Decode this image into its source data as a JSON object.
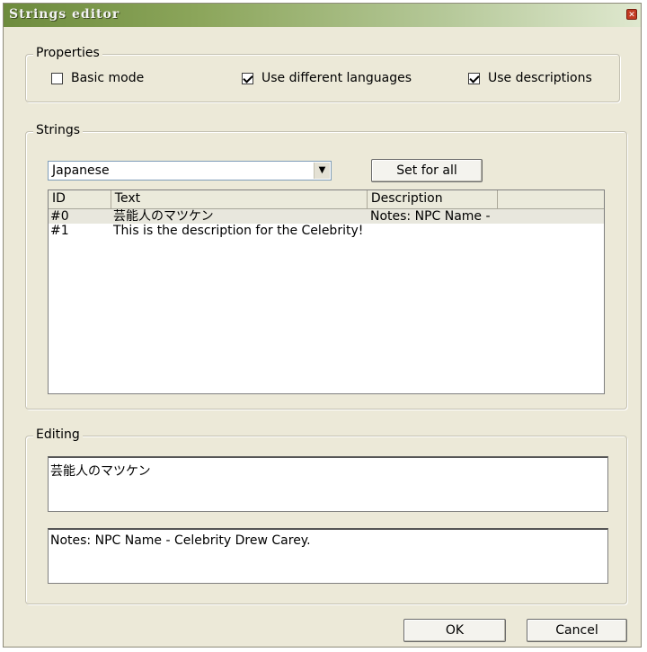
{
  "window": {
    "title": "Strings editor"
  },
  "properties": {
    "legend": "Properties",
    "basic_mode": {
      "label": "Basic mode",
      "checked": false
    },
    "use_languages": {
      "label": "Use different languages",
      "checked": true
    },
    "use_descriptions": {
      "label": "Use descriptions",
      "checked": true
    }
  },
  "strings": {
    "legend": "Strings",
    "language": "Japanese",
    "set_for_all": "Set for all",
    "columns": [
      "ID",
      "Text",
      "Description"
    ],
    "rows": [
      {
        "id": "#0",
        "text": "芸能人のマツケン",
        "description": "Notes: NPC Name -"
      },
      {
        "id": "#1",
        "text": "This is the description for the Celebrity!",
        "description": ""
      }
    ]
  },
  "editing": {
    "legend": "Editing",
    "text_value": "芸能人のマツケン",
    "description_value": "Notes: NPC Name - Celebrity Drew Carey."
  },
  "footer": {
    "ok": "OK",
    "cancel": "Cancel"
  }
}
